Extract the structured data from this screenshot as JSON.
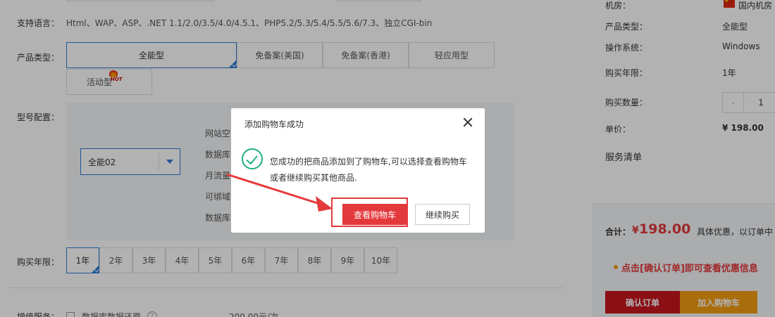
{
  "form": {
    "languages_label": "支持语言：",
    "languages_value": "Html、WAP、ASP、.NET 1.1/2.0/3.5/4.0/4.5.1、PHP5.2/5.3/5.4/5.5/5.6/7.3、独立CGI-bin",
    "product_type_label": "产品类型：",
    "product_types": [
      "全能型",
      "免备案(美国)",
      "免备案(香港)",
      "轻应用型",
      "活动型"
    ],
    "product_type_selected": "全能型",
    "hot_badge": "HOT",
    "model_label": "型号配置：",
    "model_select_value": "全能02",
    "spec_labels": [
      "网站空",
      "数据库",
      "月流量",
      "可绑域",
      "数据库"
    ],
    "years_label": "购买年限：",
    "years": [
      "1年",
      "2年",
      "3年",
      "4年",
      "5年",
      "6年",
      "7年",
      "8年",
      "9年",
      "10年"
    ],
    "year_selected": "1年",
    "addon_label": "增值服务：",
    "addon_name": "数据库数据还原",
    "addon_price": "200.00元/次"
  },
  "summary": {
    "room_label": "机房：",
    "room_value": "国内机房",
    "type_label": "产品类型：",
    "type_value": "全能型",
    "os_label": "操作系统：",
    "os_value": "Windows",
    "years_label": "购买年限：",
    "years_value": "1年",
    "qty_label": "购买数量：",
    "qty_minus": "-",
    "qty_value": "1",
    "unit_price_label": "单价：",
    "unit_price_value": "¥ 198.00",
    "service_list_label": "服务清单",
    "total_label": "合计：",
    "total_currency": "¥",
    "total_value": "198.00",
    "discount_note": "具体优惠，以订单中",
    "promo_text": "点击[确认订单]即可查看优惠信息",
    "confirm_button": "确认订单",
    "add_cart_button": "加入购物车"
  },
  "dialog": {
    "title": "添加购物车成功",
    "message_line1": "您成功的把商品添加到了购物车,可以选择查看购物车",
    "message_line2": "或者继续购买其他商品.",
    "view_cart_button": "查看购物车",
    "continue_button": "继续购买"
  },
  "colors": {
    "accent_blue": "#2f7bd6",
    "primary_red": "#e4393c",
    "confirm_red": "#c8161d",
    "orange": "#f39c12",
    "success_green": "#20b07c"
  }
}
